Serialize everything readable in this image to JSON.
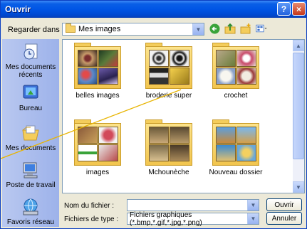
{
  "window": {
    "title": "Ouvrir",
    "help_glyph": "?",
    "close_glyph": "×"
  },
  "toolbar": {
    "look_in_label": "Regarder dans :",
    "look_in_value": "Mes images",
    "icons": [
      "back-icon",
      "up-folder-icon",
      "new-folder-icon",
      "view-menu-icon"
    ]
  },
  "places": [
    {
      "label": "Mes documents récents",
      "icon": "recent-documents-icon"
    },
    {
      "label": "Bureau",
      "icon": "desktop-icon"
    },
    {
      "label": "Mes documents",
      "icon": "my-documents-icon"
    },
    {
      "label": "Poste de travail",
      "icon": "my-computer-icon"
    },
    {
      "label": "Favoris réseau",
      "icon": "network-places-icon"
    }
  ],
  "folders": [
    {
      "name": "belles images"
    },
    {
      "name": "broderie super"
    },
    {
      "name": "crochet"
    },
    {
      "name": "images"
    },
    {
      "name": "Mchounèche"
    },
    {
      "name": "Nouveau dossier"
    }
  ],
  "form": {
    "filename_label": "Nom du fichier :",
    "filename_value": "",
    "filetype_label": "Fichiers de type :",
    "filetype_value": "Fichiers graphiques (*.bmp,*.gif,*.jpg,*.png)",
    "open_button": "Ouvrir",
    "cancel_button": "Annuler"
  },
  "colors": {
    "titlebar": "#0055e5",
    "dialog_bg": "#ece9d8",
    "places_bar": "#9db2ea",
    "folder": "#f2c54e",
    "callout_line": "#e8b400"
  }
}
